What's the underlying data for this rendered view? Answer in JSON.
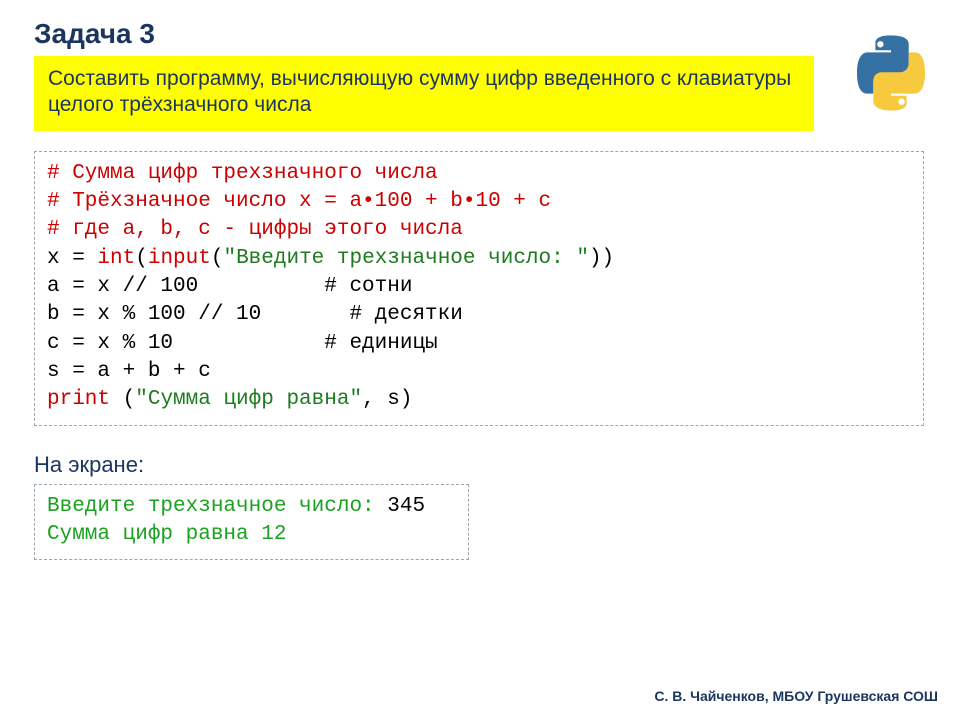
{
  "title": "Задача 3",
  "task": "Составить программу, вычисляющую сумму цифр введенного с клавиатуры целого трёхзначного числа",
  "code": {
    "c1": "# Сумма цифр трехзначного числа",
    "c2": "# Трёхзначное число x = a•100 + b•10 + c",
    "c3": "# где a, b, c - цифры этого числа",
    "l4a": "x = ",
    "l4_int": "int",
    "l4b": "(",
    "l4_input": "input",
    "l4c": "(",
    "l4_str": "\"Введите трехзначное число: \"",
    "l4d": "))",
    "l5": "a = x // 100          # сотни",
    "l6": "b = x % 100 // 10       # десятки",
    "l7": "c = x % 10            # единицы",
    "l8": "s = a + b + c",
    "l9_print": "print",
    "l9a": " (",
    "l9_str": "\"Сумма цифр равна\"",
    "l9b": ", s)"
  },
  "screen_label": "На экране:",
  "output": {
    "prompt": "Введите трехзначное число: ",
    "user_input": "345",
    "result": "Сумма цифр равна 12"
  },
  "footer": "С. В. Чайченков, МБОУ Грушевская СОШ"
}
